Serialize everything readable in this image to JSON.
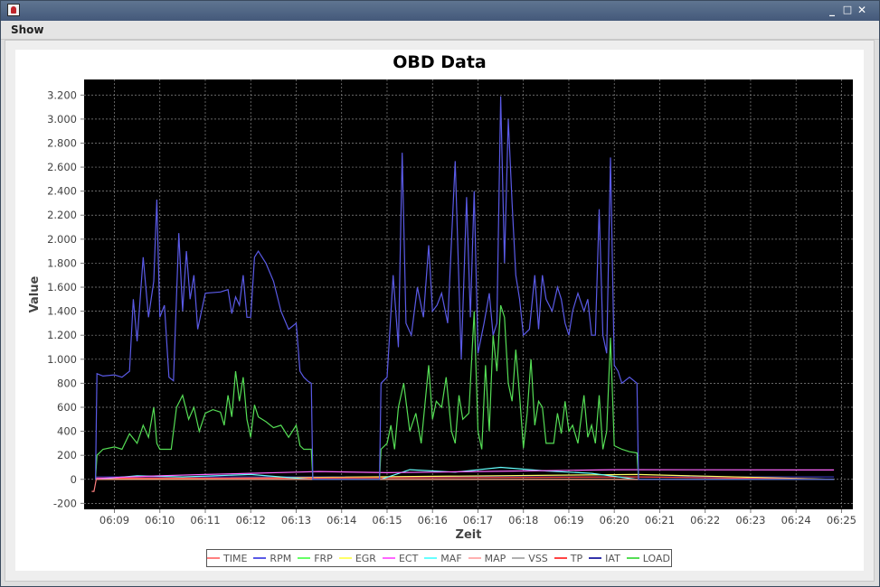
{
  "window": {
    "title_icon": "java-app-icon",
    "buttons": [
      "_",
      "□",
      "✕"
    ]
  },
  "menu": {
    "items": [
      "Show"
    ]
  },
  "chart_data": {
    "type": "line",
    "title": "OBD Data",
    "xlabel": "Zeit",
    "ylabel": "Value",
    "ylim": [
      -250,
      3330
    ],
    "yticks": [
      -200,
      0,
      200,
      400,
      600,
      800,
      1000,
      1200,
      1400,
      1600,
      1800,
      2000,
      2200,
      2400,
      2600,
      2800,
      3000,
      3200
    ],
    "ytick_labels": [
      "-200",
      "0",
      "200",
      "400",
      "600",
      "800",
      "1.000",
      "1.200",
      "1.400",
      "1.600",
      "1.800",
      "2.000",
      "2.200",
      "2.400",
      "2.600",
      "2.800",
      "3.000",
      "3.200"
    ],
    "xlim": [
      "06:08:20",
      "06:25:15"
    ],
    "xticks": [
      "06:09",
      "06:10",
      "06:11",
      "06:12",
      "06:13",
      "06:14",
      "06:15",
      "06:16",
      "06:17",
      "06:18",
      "06:19",
      "06:20",
      "06:21",
      "06:22",
      "06:23",
      "06:24",
      "06:25"
    ],
    "grid": true,
    "background": "#000000",
    "legend_position": "bottom",
    "series": [
      {
        "name": "TIME",
        "color": "#ff8080",
        "points": [
          [
            "06:08:30",
            -100
          ],
          [
            "06:08:33",
            -100
          ],
          [
            "06:08:36",
            0
          ],
          [
            "06:20:40",
            0
          ],
          [
            "06:24:50",
            0
          ]
        ]
      },
      {
        "name": "RPM",
        "color": "#5a5ae6",
        "points": [
          [
            "06:08:35",
            0
          ],
          [
            "06:08:37",
            880
          ],
          [
            "06:08:45",
            860
          ],
          [
            "06:09:00",
            870
          ],
          [
            "06:09:10",
            850
          ],
          [
            "06:09:20",
            900
          ],
          [
            "06:09:25",
            1500
          ],
          [
            "06:09:30",
            1150
          ],
          [
            "06:09:38",
            1850
          ],
          [
            "06:09:45",
            1350
          ],
          [
            "06:09:52",
            1650
          ],
          [
            "06:09:56",
            2330
          ],
          [
            "06:10:00",
            1350
          ],
          [
            "06:10:06",
            1450
          ],
          [
            "06:10:12",
            850
          ],
          [
            "06:10:18",
            820
          ],
          [
            "06:10:25",
            2050
          ],
          [
            "06:10:30",
            1400
          ],
          [
            "06:10:35",
            1900
          ],
          [
            "06:10:40",
            1500
          ],
          [
            "06:10:45",
            1700
          ],
          [
            "06:10:50",
            1250
          ],
          [
            "06:10:55",
            1400
          ],
          [
            "06:11:00",
            1550
          ],
          [
            "06:11:20",
            1560
          ],
          [
            "06:11:30",
            1580
          ],
          [
            "06:11:35",
            1380
          ],
          [
            "06:11:40",
            1520
          ],
          [
            "06:11:45",
            1450
          ],
          [
            "06:11:50",
            1700
          ],
          [
            "06:11:55",
            1350
          ],
          [
            "06:12:00",
            1350
          ],
          [
            "06:12:05",
            1850
          ],
          [
            "06:12:10",
            1900
          ],
          [
            "06:12:20",
            1800
          ],
          [
            "06:12:30",
            1650
          ],
          [
            "06:12:40",
            1400
          ],
          [
            "06:12:50",
            1250
          ],
          [
            "06:13:00",
            1300
          ],
          [
            "06:13:05",
            900
          ],
          [
            "06:13:10",
            850
          ],
          [
            "06:13:15",
            820
          ],
          [
            "06:13:20",
            800
          ],
          [
            "06:13:22",
            0
          ],
          [
            "06:14:50",
            0
          ],
          [
            "06:14:52",
            800
          ],
          [
            "06:15:00",
            850
          ],
          [
            "06:15:08",
            1700
          ],
          [
            "06:15:15",
            1100
          ],
          [
            "06:15:20",
            2720
          ],
          [
            "06:15:25",
            1300
          ],
          [
            "06:15:32",
            1200
          ],
          [
            "06:15:40",
            1600
          ],
          [
            "06:15:48",
            1350
          ],
          [
            "06:15:55",
            1950
          ],
          [
            "06:16:00",
            1400
          ],
          [
            "06:16:06",
            1450
          ],
          [
            "06:16:12",
            1550
          ],
          [
            "06:16:20",
            1300
          ],
          [
            "06:16:30",
            2650
          ],
          [
            "06:16:38",
            1000
          ],
          [
            "06:16:45",
            2350
          ],
          [
            "06:16:50",
            1350
          ],
          [
            "06:16:55",
            2400
          ],
          [
            "06:17:00",
            1050
          ],
          [
            "06:17:08",
            1300
          ],
          [
            "06:17:15",
            1550
          ],
          [
            "06:17:20",
            1200
          ],
          [
            "06:17:25",
            1300
          ],
          [
            "06:17:30",
            3190
          ],
          [
            "06:17:35",
            1800
          ],
          [
            "06:17:40",
            3000
          ],
          [
            "06:17:45",
            2300
          ],
          [
            "06:17:50",
            1700
          ],
          [
            "06:17:55",
            1500
          ],
          [
            "06:18:00",
            1200
          ],
          [
            "06:18:08",
            1250
          ],
          [
            "06:18:15",
            1700
          ],
          [
            "06:18:20",
            1250
          ],
          [
            "06:18:25",
            1700
          ],
          [
            "06:18:30",
            1500
          ],
          [
            "06:18:38",
            1400
          ],
          [
            "06:18:45",
            1600
          ],
          [
            "06:18:50",
            1500
          ],
          [
            "06:18:55",
            1300
          ],
          [
            "06:19:00",
            1200
          ],
          [
            "06:19:05",
            1400
          ],
          [
            "06:19:12",
            1550
          ],
          [
            "06:19:20",
            1400
          ],
          [
            "06:19:25",
            1500
          ],
          [
            "06:19:30",
            1200
          ],
          [
            "06:19:35",
            1200
          ],
          [
            "06:19:40",
            2250
          ],
          [
            "06:19:45",
            1200
          ],
          [
            "06:19:50",
            1050
          ],
          [
            "06:19:55",
            2680
          ],
          [
            "06:20:00",
            950
          ],
          [
            "06:20:05",
            900
          ],
          [
            "06:20:10",
            800
          ],
          [
            "06:20:20",
            850
          ],
          [
            "06:20:30",
            800
          ],
          [
            "06:20:32",
            0
          ],
          [
            "06:21:00",
            0
          ],
          [
            "06:24:50",
            0
          ]
        ]
      },
      {
        "name": "FRP",
        "color": "#66ff66",
        "points": [
          [
            "06:08:35",
            0
          ],
          [
            "06:24:50",
            0
          ]
        ]
      },
      {
        "name": "EGR",
        "color": "#ffff66",
        "points": [
          [
            "06:08:35",
            0
          ],
          [
            "06:20:30",
            40
          ],
          [
            "06:24:50",
            0
          ]
        ]
      },
      {
        "name": "ECT",
        "color": "#ff66ff",
        "points": [
          [
            "06:08:35",
            5
          ],
          [
            "06:09:00",
            15
          ],
          [
            "06:10:00",
            30
          ],
          [
            "06:11:00",
            40
          ],
          [
            "06:12:00",
            50
          ],
          [
            "06:13:00",
            60
          ],
          [
            "06:13:30",
            65
          ],
          [
            "06:15:00",
            55
          ],
          [
            "06:16:00",
            60
          ],
          [
            "06:17:00",
            65
          ],
          [
            "06:18:00",
            70
          ],
          [
            "06:19:00",
            75
          ],
          [
            "06:20:00",
            80
          ],
          [
            "06:20:30",
            80
          ],
          [
            "06:24:50",
            78
          ]
        ]
      },
      {
        "name": "MAF",
        "color": "#66ffff",
        "points": [
          [
            "06:08:35",
            0
          ],
          [
            "06:09:30",
            30
          ],
          [
            "06:10:30",
            20
          ],
          [
            "06:12:00",
            40
          ],
          [
            "06:13:20",
            0
          ],
          [
            "06:14:52",
            0
          ],
          [
            "06:15:30",
            80
          ],
          [
            "06:16:30",
            60
          ],
          [
            "06:17:30",
            100
          ],
          [
            "06:18:30",
            70
          ],
          [
            "06:19:30",
            50
          ],
          [
            "06:20:30",
            0
          ],
          [
            "06:24:50",
            0
          ]
        ]
      },
      {
        "name": "MAP",
        "color": "#ffb0b0",
        "points": [
          [
            "06:08:35",
            0
          ],
          [
            "06:24:50",
            0
          ]
        ]
      },
      {
        "name": "VSS",
        "color": "#b0b0b0",
        "points": [
          [
            "06:08:35",
            0
          ],
          [
            "06:24:50",
            0
          ]
        ]
      },
      {
        "name": "TP",
        "color": "#ff4444",
        "points": [
          [
            "06:08:35",
            10
          ],
          [
            "06:13:20",
            10
          ],
          [
            "06:20:30",
            20
          ],
          [
            "06:24:50",
            0
          ]
        ]
      },
      {
        "name": "IAT",
        "color": "#3333aa",
        "points": [
          [
            "06:08:35",
            20
          ],
          [
            "06:24:50",
            20
          ]
        ]
      },
      {
        "name": "LOAD",
        "color": "#55dd55",
        "points": [
          [
            "06:08:35",
            0
          ],
          [
            "06:08:37",
            200
          ],
          [
            "06:08:45",
            250
          ],
          [
            "06:09:00",
            270
          ],
          [
            "06:09:10",
            250
          ],
          [
            "06:09:20",
            380
          ],
          [
            "06:09:30",
            300
          ],
          [
            "06:09:38",
            450
          ],
          [
            "06:09:45",
            350
          ],
          [
            "06:09:52",
            600
          ],
          [
            "06:09:56",
            300
          ],
          [
            "06:10:00",
            250
          ],
          [
            "06:10:08",
            250
          ],
          [
            "06:10:15",
            250
          ],
          [
            "06:10:22",
            600
          ],
          [
            "06:10:30",
            700
          ],
          [
            "06:10:38",
            500
          ],
          [
            "06:10:45",
            600
          ],
          [
            "06:10:52",
            400
          ],
          [
            "06:11:00",
            550
          ],
          [
            "06:11:10",
            580
          ],
          [
            "06:11:20",
            560
          ],
          [
            "06:11:25",
            450
          ],
          [
            "06:11:30",
            700
          ],
          [
            "06:11:35",
            520
          ],
          [
            "06:11:40",
            900
          ],
          [
            "06:11:45",
            650
          ],
          [
            "06:11:50",
            850
          ],
          [
            "06:11:55",
            500
          ],
          [
            "06:12:00",
            350
          ],
          [
            "06:12:05",
            620
          ],
          [
            "06:12:10",
            520
          ],
          [
            "06:12:20",
            480
          ],
          [
            "06:12:30",
            430
          ],
          [
            "06:12:40",
            450
          ],
          [
            "06:12:50",
            350
          ],
          [
            "06:13:00",
            450
          ],
          [
            "06:13:05",
            280
          ],
          [
            "06:13:10",
            250
          ],
          [
            "06:13:20",
            250
          ],
          [
            "06:13:22",
            0
          ],
          [
            "06:14:50",
            0
          ],
          [
            "06:14:52",
            250
          ],
          [
            "06:15:00",
            300
          ],
          [
            "06:15:05",
            450
          ],
          [
            "06:15:10",
            250
          ],
          [
            "06:15:15",
            600
          ],
          [
            "06:15:22",
            800
          ],
          [
            "06:15:30",
            400
          ],
          [
            "06:15:38",
            550
          ],
          [
            "06:15:45",
            300
          ],
          [
            "06:15:55",
            950
          ],
          [
            "06:16:00",
            500
          ],
          [
            "06:16:05",
            650
          ],
          [
            "06:16:12",
            600
          ],
          [
            "06:16:18",
            850
          ],
          [
            "06:16:25",
            400
          ],
          [
            "06:16:30",
            300
          ],
          [
            "06:16:35",
            700
          ],
          [
            "06:16:40",
            500
          ],
          [
            "06:16:48",
            550
          ],
          [
            "06:16:55",
            1400
          ],
          [
            "06:17:00",
            400
          ],
          [
            "06:17:05",
            250
          ],
          [
            "06:17:10",
            950
          ],
          [
            "06:17:15",
            400
          ],
          [
            "06:17:20",
            1200
          ],
          [
            "06:17:25",
            900
          ],
          [
            "06:17:30",
            1450
          ],
          [
            "06:17:35",
            1350
          ],
          [
            "06:17:40",
            800
          ],
          [
            "06:17:45",
            650
          ],
          [
            "06:17:50",
            1080
          ],
          [
            "06:17:55",
            700
          ],
          [
            "06:18:00",
            260
          ],
          [
            "06:18:05",
            550
          ],
          [
            "06:18:10",
            1000
          ],
          [
            "06:18:15",
            450
          ],
          [
            "06:18:20",
            650
          ],
          [
            "06:18:25",
            600
          ],
          [
            "06:18:30",
            300
          ],
          [
            "06:18:40",
            300
          ],
          [
            "06:18:45",
            550
          ],
          [
            "06:18:50",
            380
          ],
          [
            "06:18:55",
            650
          ],
          [
            "06:19:00",
            400
          ],
          [
            "06:19:05",
            450
          ],
          [
            "06:19:12",
            300
          ],
          [
            "06:19:20",
            700
          ],
          [
            "06:19:25",
            350
          ],
          [
            "06:19:30",
            450
          ],
          [
            "06:19:35",
            300
          ],
          [
            "06:19:40",
            700
          ],
          [
            "06:19:45",
            250
          ],
          [
            "06:19:50",
            400
          ],
          [
            "06:19:55",
            1180
          ],
          [
            "06:20:00",
            280
          ],
          [
            "06:20:10",
            250
          ],
          [
            "06:20:20",
            230
          ],
          [
            "06:20:30",
            220
          ],
          [
            "06:20:32",
            0
          ],
          [
            "06:21:00",
            0
          ],
          [
            "06:24:50",
            0
          ]
        ]
      }
    ]
  }
}
